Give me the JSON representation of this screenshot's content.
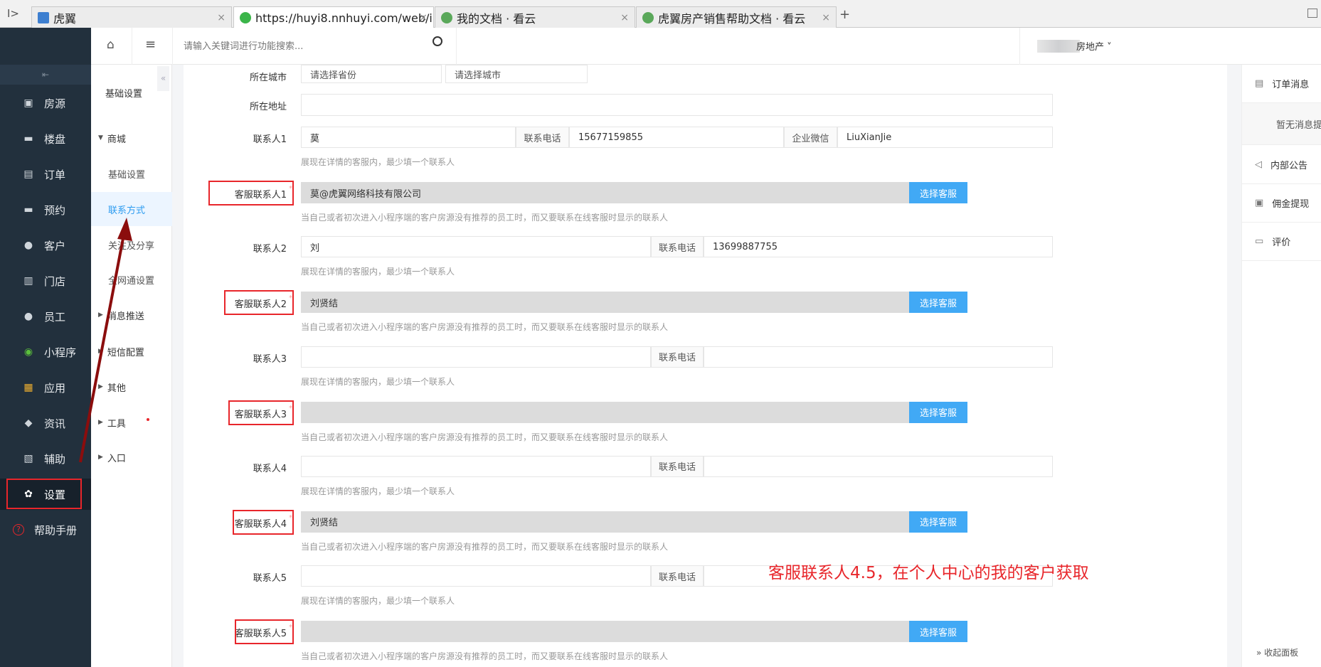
{
  "browser": {
    "tabs": [
      {
        "label": "虎翼",
        "icon": "m-logo-icon"
      },
      {
        "label": "https://huyi8.nnhuyi.com/web/i",
        "icon": "wechat-icon",
        "active": true
      },
      {
        "label": "我的文档 · 看云",
        "icon": "kancloud-icon"
      },
      {
        "label": "虎翼房产销售帮助文档 · 看云",
        "icon": "kancloud-icon"
      }
    ],
    "new_tab": "+"
  },
  "sidebar": {
    "items": [
      {
        "label": "房源",
        "icon": "house-icon"
      },
      {
        "label": "楼盘",
        "icon": "building-icon"
      },
      {
        "label": "订单",
        "icon": "document-icon"
      },
      {
        "label": "预约",
        "icon": "calendar-icon"
      },
      {
        "label": "客户",
        "icon": "user-icon"
      },
      {
        "label": "门店",
        "icon": "store-icon"
      },
      {
        "label": "员工",
        "icon": "staff-icon"
      },
      {
        "label": "小程序",
        "icon": "miniprogram-icon"
      },
      {
        "label": "应用",
        "icon": "apps-icon"
      },
      {
        "label": "资讯",
        "icon": "tag-icon"
      },
      {
        "label": "辅助",
        "icon": "tool-icon"
      },
      {
        "label": "设置",
        "icon": "gear-icon",
        "active": true
      },
      {
        "label": "帮助手册",
        "icon": "help-icon"
      }
    ]
  },
  "submenu": {
    "title": "基础设置",
    "items": [
      {
        "label": "商城",
        "group": true
      },
      {
        "label": "基础设置"
      },
      {
        "label": "联系方式",
        "active": true
      },
      {
        "label": "关注及分享"
      },
      {
        "label": "全网通设置"
      },
      {
        "label": "消息推送",
        "group": true
      },
      {
        "label": "短信配置",
        "group": true
      },
      {
        "label": "其他",
        "group": true
      },
      {
        "label": "工具",
        "group": true
      },
      {
        "label": "入口",
        "group": true
      }
    ]
  },
  "header": {
    "search_placeholder": "请输入关键词进行功能搜索...",
    "user": "房地产"
  },
  "form": {
    "city_label": "所在城市",
    "province_placeholder": "请选择省份",
    "city_placeholder": "请选择城市",
    "address_label": "所在地址",
    "address_value": "",
    "phone_label": "联系电话",
    "wechat_label": "企业微信",
    "select_button": "选择客服",
    "contact_hint": "展现在详情的客服内，最少填一个联系人",
    "service_hint": "当自己或者初次进入小程序端的客户房源没有推荐的员工时，而又要联系在线客服时显示的联系人",
    "contacts": [
      {
        "label": "联系人1",
        "name": "莫",
        "phone": "15677159855",
        "wechat": "LiuXianJie",
        "service_label": "客服联系人1",
        "service": "莫@虎翼网络科技有限公司"
      },
      {
        "label": "联系人2",
        "name": "刘",
        "phone": "13699887755",
        "service_label": "客服联系人2",
        "service": "刘贤结"
      },
      {
        "label": "联系人3",
        "name": "",
        "phone": "",
        "service_label": "客服联系人3",
        "service": ""
      },
      {
        "label": "联系人4",
        "name": "",
        "phone": "",
        "service_label": "客服联系人4",
        "service": "刘贤结"
      },
      {
        "label": "联系人5",
        "name": "",
        "phone": "",
        "service_label": "客服联系人5",
        "service": ""
      }
    ]
  },
  "annotation": "客服联系人4.5，在个人中心的我的客户获取",
  "right_panel": {
    "items": [
      "订单消息",
      "暂无消息提醒",
      "内部公告",
      "佣金提现",
      "评价"
    ],
    "collapse": "» 收起面板"
  },
  "colors": {
    "accent": "#41a9f5",
    "sidebar": "#22303d",
    "annotation": "#e8262b"
  }
}
